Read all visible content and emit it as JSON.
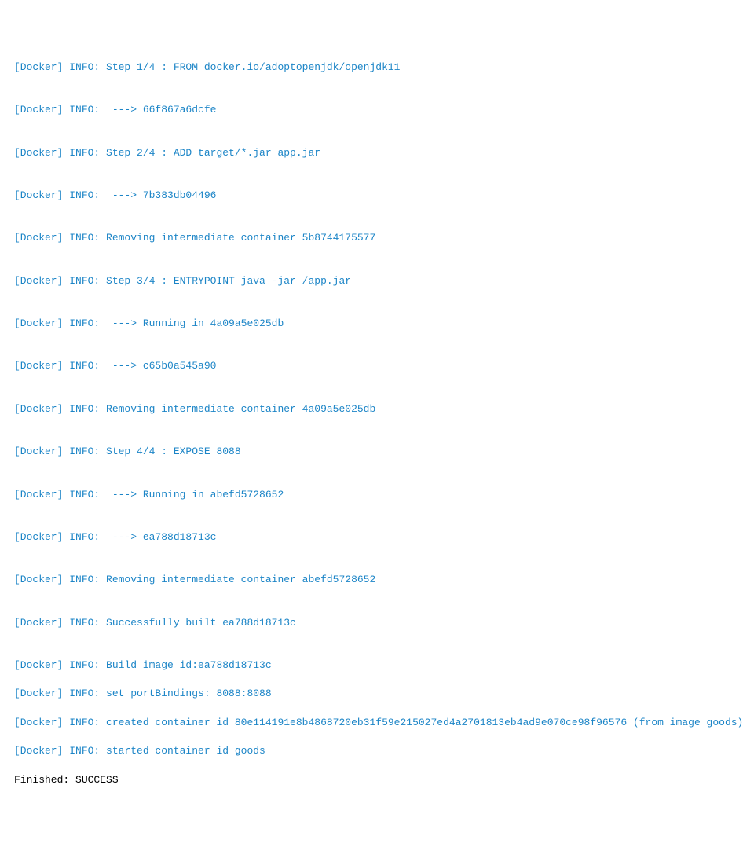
{
  "lines": {
    "l0": "[Docker] INFO: Step 1/4 : FROM docker.io/adoptopenjdk/openjdk11",
    "l1": "[Docker] INFO:  ---> 66f867a6dcfe",
    "l2": "[Docker] INFO: Step 2/4 : ADD target/*.jar app.jar",
    "l3": "[Docker] INFO:  ---> 7b383db04496",
    "l4": "[Docker] INFO: Removing intermediate container 5b8744175577",
    "l5": "[Docker] INFO: Step 3/4 : ENTRYPOINT java -jar /app.jar",
    "l6": "[Docker] INFO:  ---> Running in 4a09a5e025db",
    "l7": "[Docker] INFO:  ---> c65b0a545a90",
    "l8": "[Docker] INFO: Removing intermediate container 4a09a5e025db",
    "l9": "[Docker] INFO: Step 4/4 : EXPOSE 8088",
    "l10": "[Docker] INFO:  ---> Running in abefd5728652",
    "l11": "[Docker] INFO:  ---> ea788d18713c",
    "l12": "[Docker] INFO: Removing intermediate container abefd5728652",
    "l13": "[Docker] INFO: Successfully built ea788d18713c",
    "l14": "[Docker] INFO: Build image id:ea788d18713c",
    "l15": "[Docker] INFO: set portBindings: 8088:8088",
    "l16": "[Docker] INFO: created container id 80e114191e8b4868720eb31f59e215027ed4a2701813eb4ad9e070ce98f96576 (from image goods)",
    "l17": "[Docker] INFO: started container id goods",
    "l18": "Finished: SUCCESS"
  }
}
